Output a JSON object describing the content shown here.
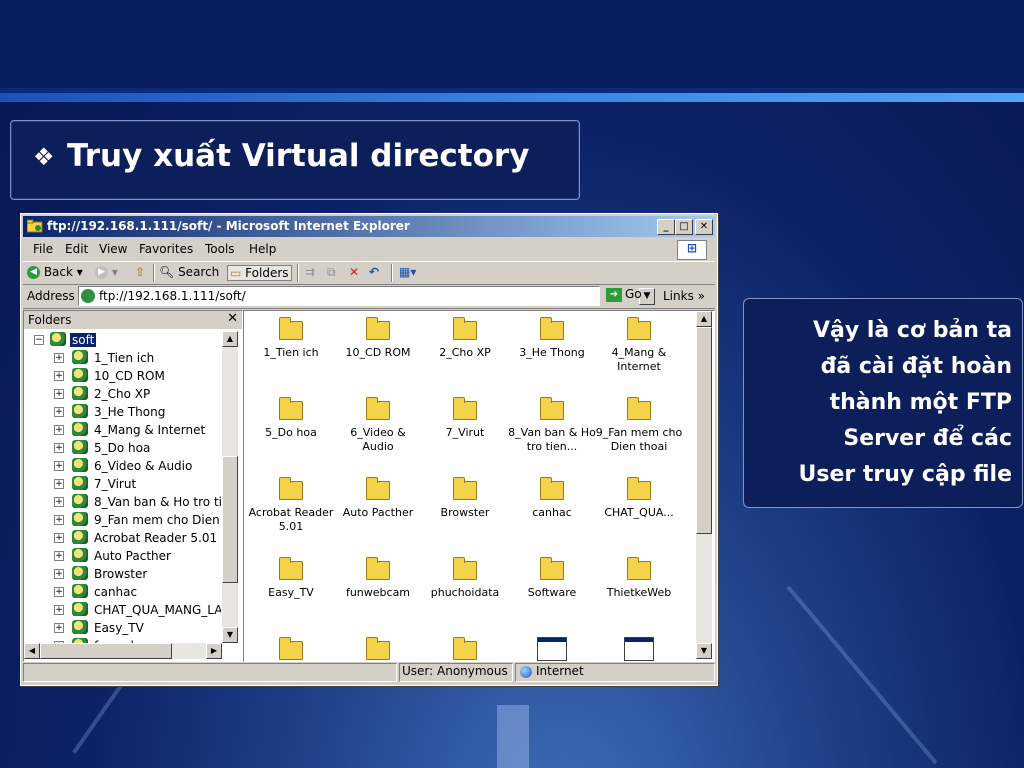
{
  "slide": {
    "title": "Truy xuất Virtual directory",
    "bullet_glyph": "❖",
    "note_lines": [
      "Vậy là cơ bản ta",
      "đã cài đặt hoàn",
      "thành một FTP",
      "Server để các",
      "User truy cập file"
    ]
  },
  "ie": {
    "title": "ftp://192.168.1.111/soft/ - Microsoft Internet Explorer",
    "menu": [
      "File",
      "Edit",
      "View",
      "Favorites",
      "Tools",
      "Help"
    ],
    "toolbar": {
      "back": "Back",
      "search": "Search",
      "folders": "Folders"
    },
    "address_label": "Address",
    "address_value": "ftp://192.168.1.111/soft/",
    "go_label": "Go",
    "links_label": "Links",
    "folders_pane_title": "Folders",
    "tree_root": "soft",
    "tree_items": [
      "1_Tien ich",
      "10_CD ROM",
      "2_Cho XP",
      "3_He Thong",
      "4_Mang & Internet",
      "5_Do hoa",
      "6_Video & Audio",
      "7_Virut",
      "8_Van ban & Ho tro ti",
      "9_Fan mem cho Dien",
      "Acrobat Reader 5.01",
      "Auto Pacther",
      "Browster",
      "canhac",
      "CHAT_QUA_MANG_LA",
      "Easy_TV",
      "funwebcam"
    ],
    "files": [
      {
        "label": "1_Tien ich",
        "icon": "folder-icon"
      },
      {
        "label": "10_CD ROM",
        "icon": "folder-icon"
      },
      {
        "label": "2_Cho XP",
        "icon": "folder-icon"
      },
      {
        "label": "3_He Thong",
        "icon": "folder-icon"
      },
      {
        "label": "4_Mang & Internet",
        "icon": "folder-icon"
      },
      {
        "label": "5_Do hoa",
        "icon": "folder-icon"
      },
      {
        "label": "6_Video & Audio",
        "icon": "folder-icon"
      },
      {
        "label": "7_Virut",
        "icon": "folder-icon"
      },
      {
        "label": "8_Van ban & Ho tro tien...",
        "icon": "folder-icon"
      },
      {
        "label": "9_Fan mem cho Dien thoai",
        "icon": "folder-icon"
      },
      {
        "label": "Acrobat Reader 5.01",
        "icon": "folder-icon"
      },
      {
        "label": "Auto Pacther",
        "icon": "folder-icon"
      },
      {
        "label": "Browster",
        "icon": "folder-icon"
      },
      {
        "label": "canhac",
        "icon": "folder-icon"
      },
      {
        "label": "CHAT_QUA...",
        "icon": "folder-icon"
      },
      {
        "label": "Easy_TV",
        "icon": "folder-icon"
      },
      {
        "label": "funwebcam",
        "icon": "folder-icon"
      },
      {
        "label": "phuchoidata",
        "icon": "folder-icon"
      },
      {
        "label": "Software",
        "icon": "folder-icon"
      },
      {
        "label": "ThietkeWeb",
        "icon": "folder-icon"
      },
      {
        "label": "",
        "icon": "folder-icon"
      },
      {
        "label": "",
        "icon": "folder-icon"
      },
      {
        "label": "",
        "icon": "folder-icon"
      },
      {
        "label": "",
        "icon": "window-icon"
      },
      {
        "label": "",
        "icon": "window-icon"
      }
    ],
    "status_user": "User: Anonymous",
    "status_zone": "Internet"
  },
  "colors": {
    "title_bar": "#0a246a",
    "slide_bg": "#0d2266",
    "accent_stripe": "#3a86e6"
  }
}
